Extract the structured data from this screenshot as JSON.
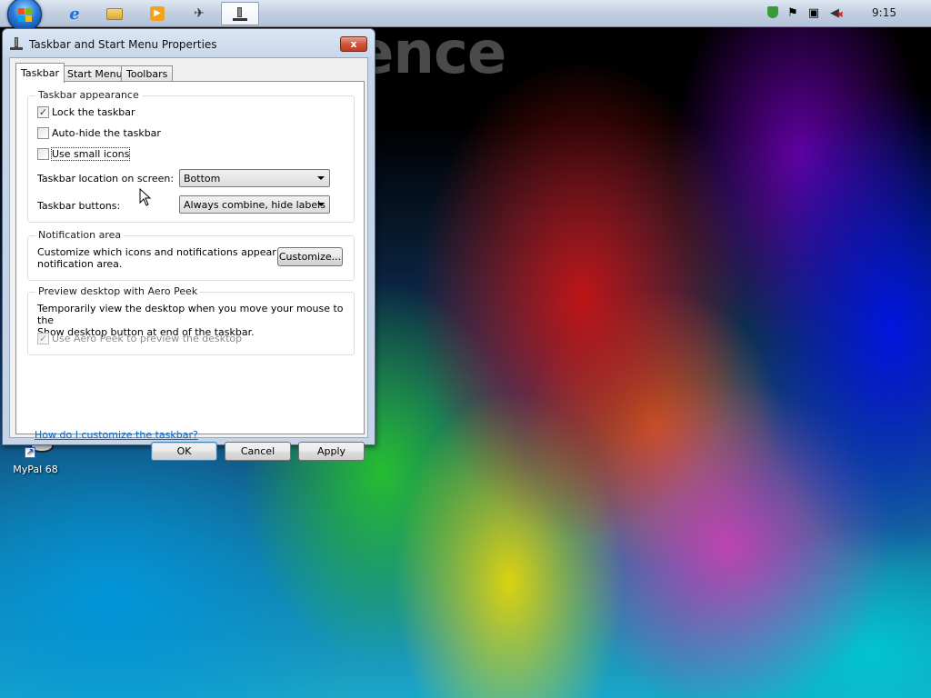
{
  "desktop": {
    "wallpaper_text": "ence",
    "icons": [
      {
        "label": "MyPal 68",
        "icon": "mypal-icon"
      }
    ]
  },
  "taskbar": {
    "start_icon": "windows-orb-icon",
    "pinned": [
      {
        "name": "internet-explorer",
        "icon": "ie-icon",
        "glyph": "e"
      },
      {
        "name": "explorer",
        "icon": "folder-icon",
        "glyph": "▬"
      },
      {
        "name": "media-player",
        "icon": "media-player-icon",
        "glyph": "▶"
      },
      {
        "name": "mypal",
        "icon": "mypal-taskbar-icon",
        "glyph": "✈"
      },
      {
        "name": "taskbar-properties",
        "icon": "taskbar-properties-icon",
        "glyph": "┻",
        "active": true
      }
    ],
    "tray": {
      "icons": [
        "security-shield-icon",
        "action-center-flag-icon",
        "network-icon",
        "volume-muted-icon"
      ],
      "clock": "9:15"
    }
  },
  "dialog": {
    "title": "Taskbar and Start Menu Properties",
    "close_label": "x",
    "tabs": [
      {
        "label": "Taskbar",
        "selected": true
      },
      {
        "label": "Start Menu",
        "selected": false
      },
      {
        "label": "Toolbars",
        "selected": false
      }
    ],
    "appearance": {
      "title": "Taskbar appearance",
      "lock_label": "Lock the taskbar",
      "lock_checked": true,
      "autohide_label": "Auto-hide the taskbar",
      "autohide_checked": false,
      "small_icons_label": "Use small icons",
      "small_icons_checked": false,
      "location_label": "Taskbar location on screen:",
      "location_value": "Bottom",
      "buttons_label": "Taskbar buttons:",
      "buttons_value": "Always combine, hide labels"
    },
    "notification": {
      "title": "Notification area",
      "desc_line1": "Customize which icons and notifications appear in the",
      "desc_line2": "notification area.",
      "customize_label": "Customize..."
    },
    "aero_peek": {
      "title": "Preview desktop with Aero Peek",
      "desc_line1": "Temporarily view the desktop when you move your mouse to the",
      "desc_line2": "Show desktop button at end of the taskbar.",
      "use_label": "Use Aero Peek to preview the desktop",
      "use_checked": true,
      "use_disabled": true
    },
    "help_link": "How do I customize the taskbar?",
    "buttons": {
      "ok": "OK",
      "cancel": "Cancel",
      "apply": "Apply"
    }
  },
  "colors": {
    "link": "#0066cc",
    "close_button": "#c13a22",
    "dialog_frame": "#c6d4e8"
  }
}
